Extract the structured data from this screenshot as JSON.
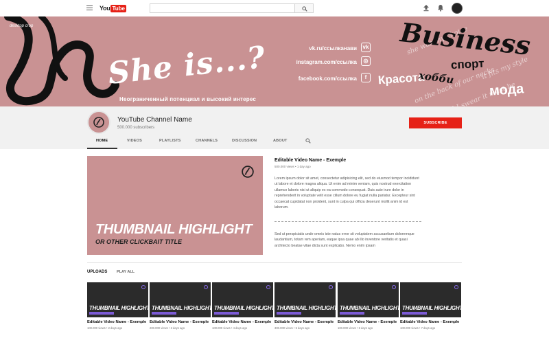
{
  "header": {
    "logo_you": "You",
    "logo_tube": "Tube",
    "search_placeholder": ""
  },
  "banner": {
    "desktop_label": "desktop crop",
    "headline": "She is...?",
    "tagline": "Неограниченный потенциал и высокий интерес",
    "social": [
      {
        "text": "vk.ru/ссылканави",
        "icon": "vk-icon"
      },
      {
        "text": "instagram.com/ссылка",
        "icon": "instagram-icon"
      },
      {
        "text": "facebook.com/ссылка",
        "icon": "facebook-icon"
      }
    ],
    "business": "Business",
    "krasota": "Красота",
    "sport": "спорт",
    "hobbi": "хобби",
    "moda": "мода",
    "colors": {
      "banner_bg": "#c99293",
      "accent": "#e62117"
    }
  },
  "channel": {
    "name": "YouTube Channel Name",
    "subscribers": "500.000 subscribers",
    "subscribe_label": "SUBSCRIBE",
    "tabs": [
      "HOME",
      "VIDEOS",
      "PLAYLISTS",
      "CHANNELS",
      "DISCUSSION",
      "ABOUT"
    ]
  },
  "featured": {
    "thumb_title": "THUMBNAIL HIGHLIGHT",
    "thumb_subtitle": "OR OTHER CLICKBAIT TITLE",
    "title": "Editable Video Name - Exemple",
    "meta": "500.000 views • 1 day ago",
    "description": "Lorem ipsum dolor sit amet, consectetur adipisicing elit, sed do eiusmod tempor incididunt ut labore et dolore magna aliqua. Ut enim ad minim veniam, quis nostrud exercitation ullamco laboris nisi ut aliquip ex ea commodo consequat. Duis aute irure dolor in reprehenderit in voluptate velit esse cillum dolore eu fugiat nulla pariatur. Excepteur sint occaecat cupidatat non proident, sunt in culpa qui officia deserunt mollit anim id est laborum.",
    "description2": "Sed ut perspiciatis unde omnis iste natus error sit voluptatem accusantium doloremque laudantium, totam rem aperiam, eaque ipsa quae ab illo inventore veritatis et quasi architecto beatae vitae dicta sunt explicabo. Nemo enim ipsam"
  },
  "uploads": {
    "label": "UPLOADS",
    "play_all": "PLAY ALL",
    "thumb_title": "THUMBNAIL HIGHLIGHT",
    "items": [
      {
        "title": "Editable Video Name - Exemple",
        "meta": "100.000 views • 2 days ago"
      },
      {
        "title": "Editable Video Name - Exemple",
        "meta": "200.000 views • 3 days ago"
      },
      {
        "title": "Editable Video Name - Exemple",
        "meta": "100.000 views • 4 days ago"
      },
      {
        "title": "Editable Video Name - Exemple",
        "meta": "300.000 views • 5 days ago"
      },
      {
        "title": "Editable Video Name - Exemple",
        "meta": "100.000 views • 6 days ago"
      },
      {
        "title": "Editable Video Name - Exemple",
        "meta": "100.000 views • 7 days ago"
      }
    ]
  }
}
